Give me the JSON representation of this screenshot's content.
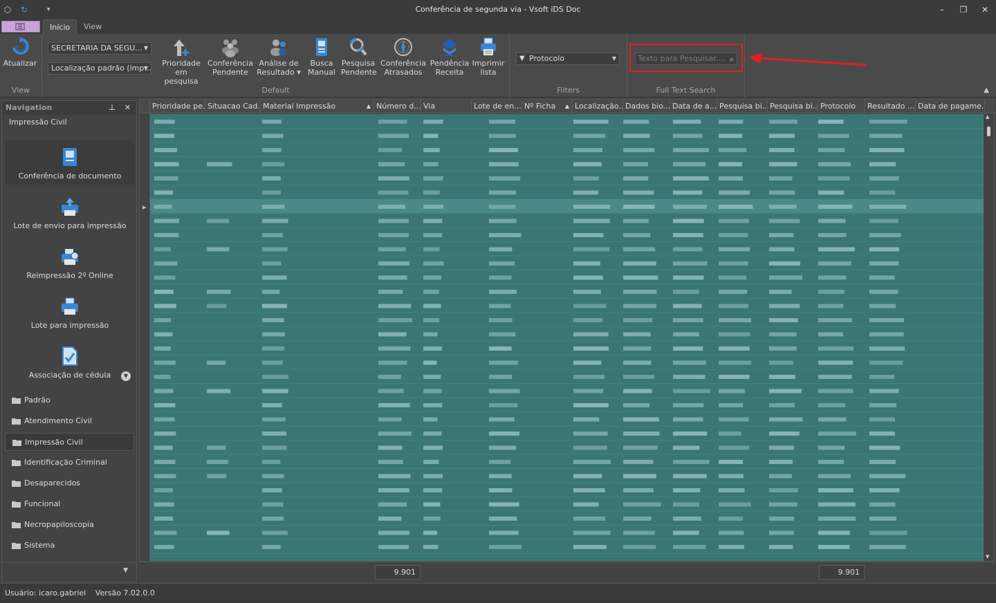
{
  "window": {
    "title": "Conferência de segunda via - Vsoft iDS Doc"
  },
  "tabs": [
    {
      "label": "Início"
    },
    {
      "label": "View"
    }
  ],
  "ribbon": {
    "view_group": {
      "label": "View",
      "refresh": "Atualizar"
    },
    "default_group": {
      "label": "Default",
      "combo_secretaria": "SECRETARIA DA SEGU...",
      "combo_localizacao": "Localização padrão (imp...",
      "buttons": [
        {
          "l1": "Prioridade",
          "l2": "em pesquisa"
        },
        {
          "l1": "Conferência",
          "l2": "Pendente"
        },
        {
          "l1": "Análise de",
          "l2": "Resultado ▾"
        },
        {
          "l1": "Busca",
          "l2": "Manual"
        },
        {
          "l1": "Pesquisa",
          "l2": "Pendente"
        },
        {
          "l1": "Conferência",
          "l2": "Atrasados"
        },
        {
          "l1": "Pendência",
          "l2": "Receita"
        },
        {
          "l1": "Imprimir",
          "l2": "lista"
        }
      ]
    },
    "filters_group": {
      "label": "Filters",
      "combo": "Protocolo"
    },
    "search_group": {
      "label": "Full Text Search",
      "placeholder": "Texto para Pesquisar...."
    }
  },
  "navigation": {
    "title": "Navigation",
    "section": "Impressão Civil",
    "items": [
      {
        "label": "Conferência de documento"
      },
      {
        "label": "Lote de envio para impressão"
      },
      {
        "label": "Reimpressão 2º Online"
      },
      {
        "label": "Lote para impressão"
      },
      {
        "label": "Associação de cédula"
      }
    ],
    "groups": [
      {
        "label": "Padrão"
      },
      {
        "label": "Atendimento Civil"
      },
      {
        "label": "Impressão Civil"
      },
      {
        "label": "Identificação Criminal"
      },
      {
        "label": "Desaparecidos"
      },
      {
        "label": "Funcional"
      },
      {
        "label": "Necropapiloscopia"
      },
      {
        "label": "Sistema"
      }
    ]
  },
  "grid": {
    "columns": [
      {
        "label": "Prioridade pe..."
      },
      {
        "label": "Situacao Cad..."
      },
      {
        "label": "Material Impressão"
      },
      {
        "label": "Número d..."
      },
      {
        "label": "Via"
      },
      {
        "label": "Lote de en..."
      },
      {
        "label": "Nº Ficha"
      },
      {
        "label": "Localização..."
      },
      {
        "label": "Dados bio..."
      },
      {
        "label": "Data de a..."
      },
      {
        "label": "Pesquisa bi..."
      },
      {
        "label": "Pesquisa bi..."
      },
      {
        "label": "Protocolo"
      },
      {
        "label": "Resultado ..."
      },
      {
        "label": "Data de pagame..."
      }
    ],
    "summary_left": "9.901",
    "summary_right": "9.901"
  },
  "status": {
    "user": "Usuário: icaro.gabriel",
    "version": "Versão 7.02.0.0"
  },
  "colors": {
    "grid_fill": "#3b7677",
    "highlight": "#e02020",
    "app_button": "#c9a3d8"
  }
}
